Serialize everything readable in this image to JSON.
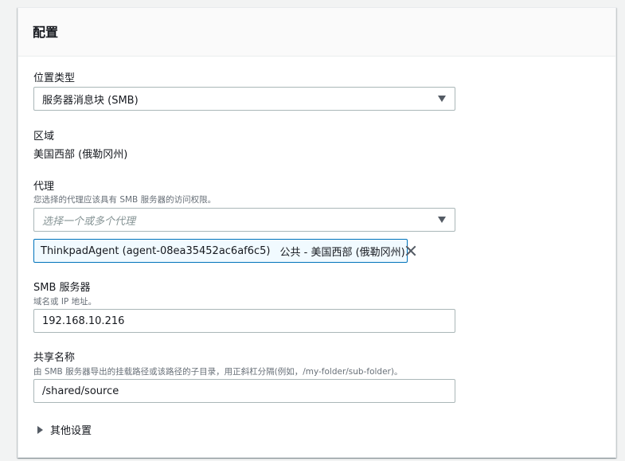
{
  "panel": {
    "title": "配置"
  },
  "location_type": {
    "label": "位置类型",
    "selected": "服务器消息块 (SMB)"
  },
  "region": {
    "label": "区域",
    "value": "美国西部 (俄勒冈州)"
  },
  "agents": {
    "label": "代理",
    "description": "您选择的代理应该具有 SMB 服务器的访问权限。",
    "placeholder": "选择一个或多个代理",
    "tokens": [
      {
        "name": "ThinkpadAgent (agent-08ea35452ac6af6c5)",
        "tag": "公共 - 美国西部 (俄勒冈州)"
      }
    ]
  },
  "smb_server": {
    "label": "SMB 服务器",
    "description": "域名或 IP 地址。",
    "value": "192.168.10.216"
  },
  "share_name": {
    "label": "共享名称",
    "description": "由 SMB 服务器导出的挂载路径或该路径的子目录，用正斜杠分隔(例如，/my-folder/sub-folder)。",
    "value": "/shared/source"
  },
  "additional_settings": {
    "label": "其他设置"
  },
  "icons": {
    "dropdown": "caret-down-icon",
    "dismiss": "close-icon",
    "expand": "caret-right-icon"
  }
}
